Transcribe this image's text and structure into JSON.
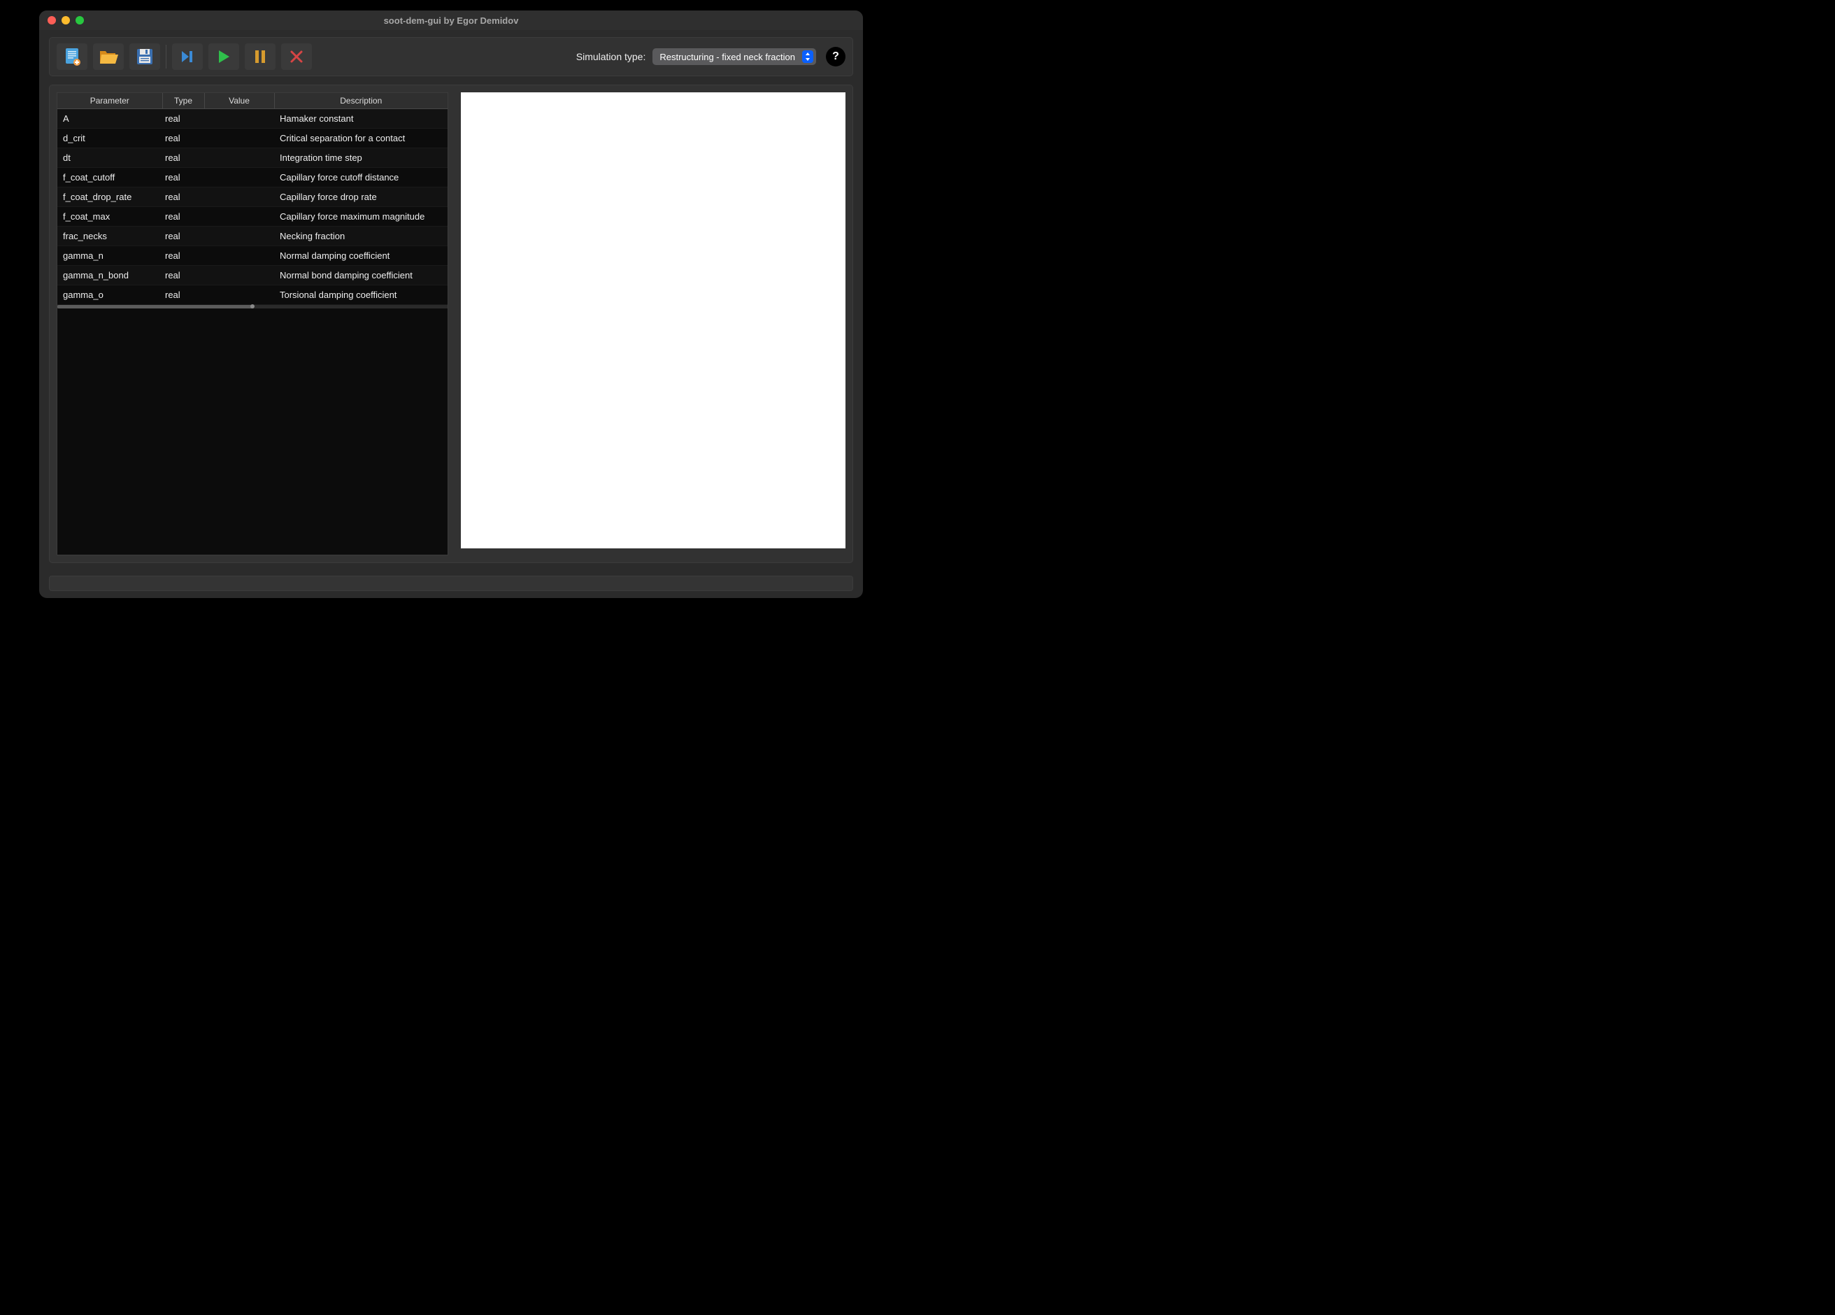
{
  "window": {
    "title": "soot-dem-gui by Egor Demidov"
  },
  "toolbar": {
    "new_icon": "new-file-icon",
    "open_icon": "open-folder-icon",
    "save_icon": "save-icon",
    "skip_icon": "skip-forward-icon",
    "play_icon": "play-icon",
    "pause_icon": "pause-icon",
    "stop_icon": "close-icon",
    "sim_type_label": "Simulation type:",
    "sim_type_value": "Restructuring - fixed neck fraction",
    "help_label": "?"
  },
  "table": {
    "headers": {
      "parameter": "Parameter",
      "type": "Type",
      "value": "Value",
      "description": "Description"
    },
    "rows": [
      {
        "parameter": "A",
        "type": "real",
        "value": "",
        "description": "Hamaker constant"
      },
      {
        "parameter": "d_crit",
        "type": "real",
        "value": "",
        "description": "Critical separation for a contact"
      },
      {
        "parameter": "dt",
        "type": "real",
        "value": "",
        "description": "Integration time step"
      },
      {
        "parameter": "f_coat_cutoff",
        "type": "real",
        "value": "",
        "description": "Capillary force cutoff distance"
      },
      {
        "parameter": "f_coat_drop_rate",
        "type": "real",
        "value": "",
        "description": "Capillary force drop rate"
      },
      {
        "parameter": "f_coat_max",
        "type": "real",
        "value": "",
        "description": "Capillary force maximum magnitude"
      },
      {
        "parameter": "frac_necks",
        "type": "real",
        "value": "",
        "description": "Necking fraction"
      },
      {
        "parameter": "gamma_n",
        "type": "real",
        "value": "",
        "description": "Normal damping coefficient"
      },
      {
        "parameter": "gamma_n_bond",
        "type": "real",
        "value": "",
        "description": "Normal bond damping coefficient"
      },
      {
        "parameter": "gamma_o",
        "type": "real",
        "value": "",
        "description": "Torsional damping coefficient"
      }
    ]
  }
}
